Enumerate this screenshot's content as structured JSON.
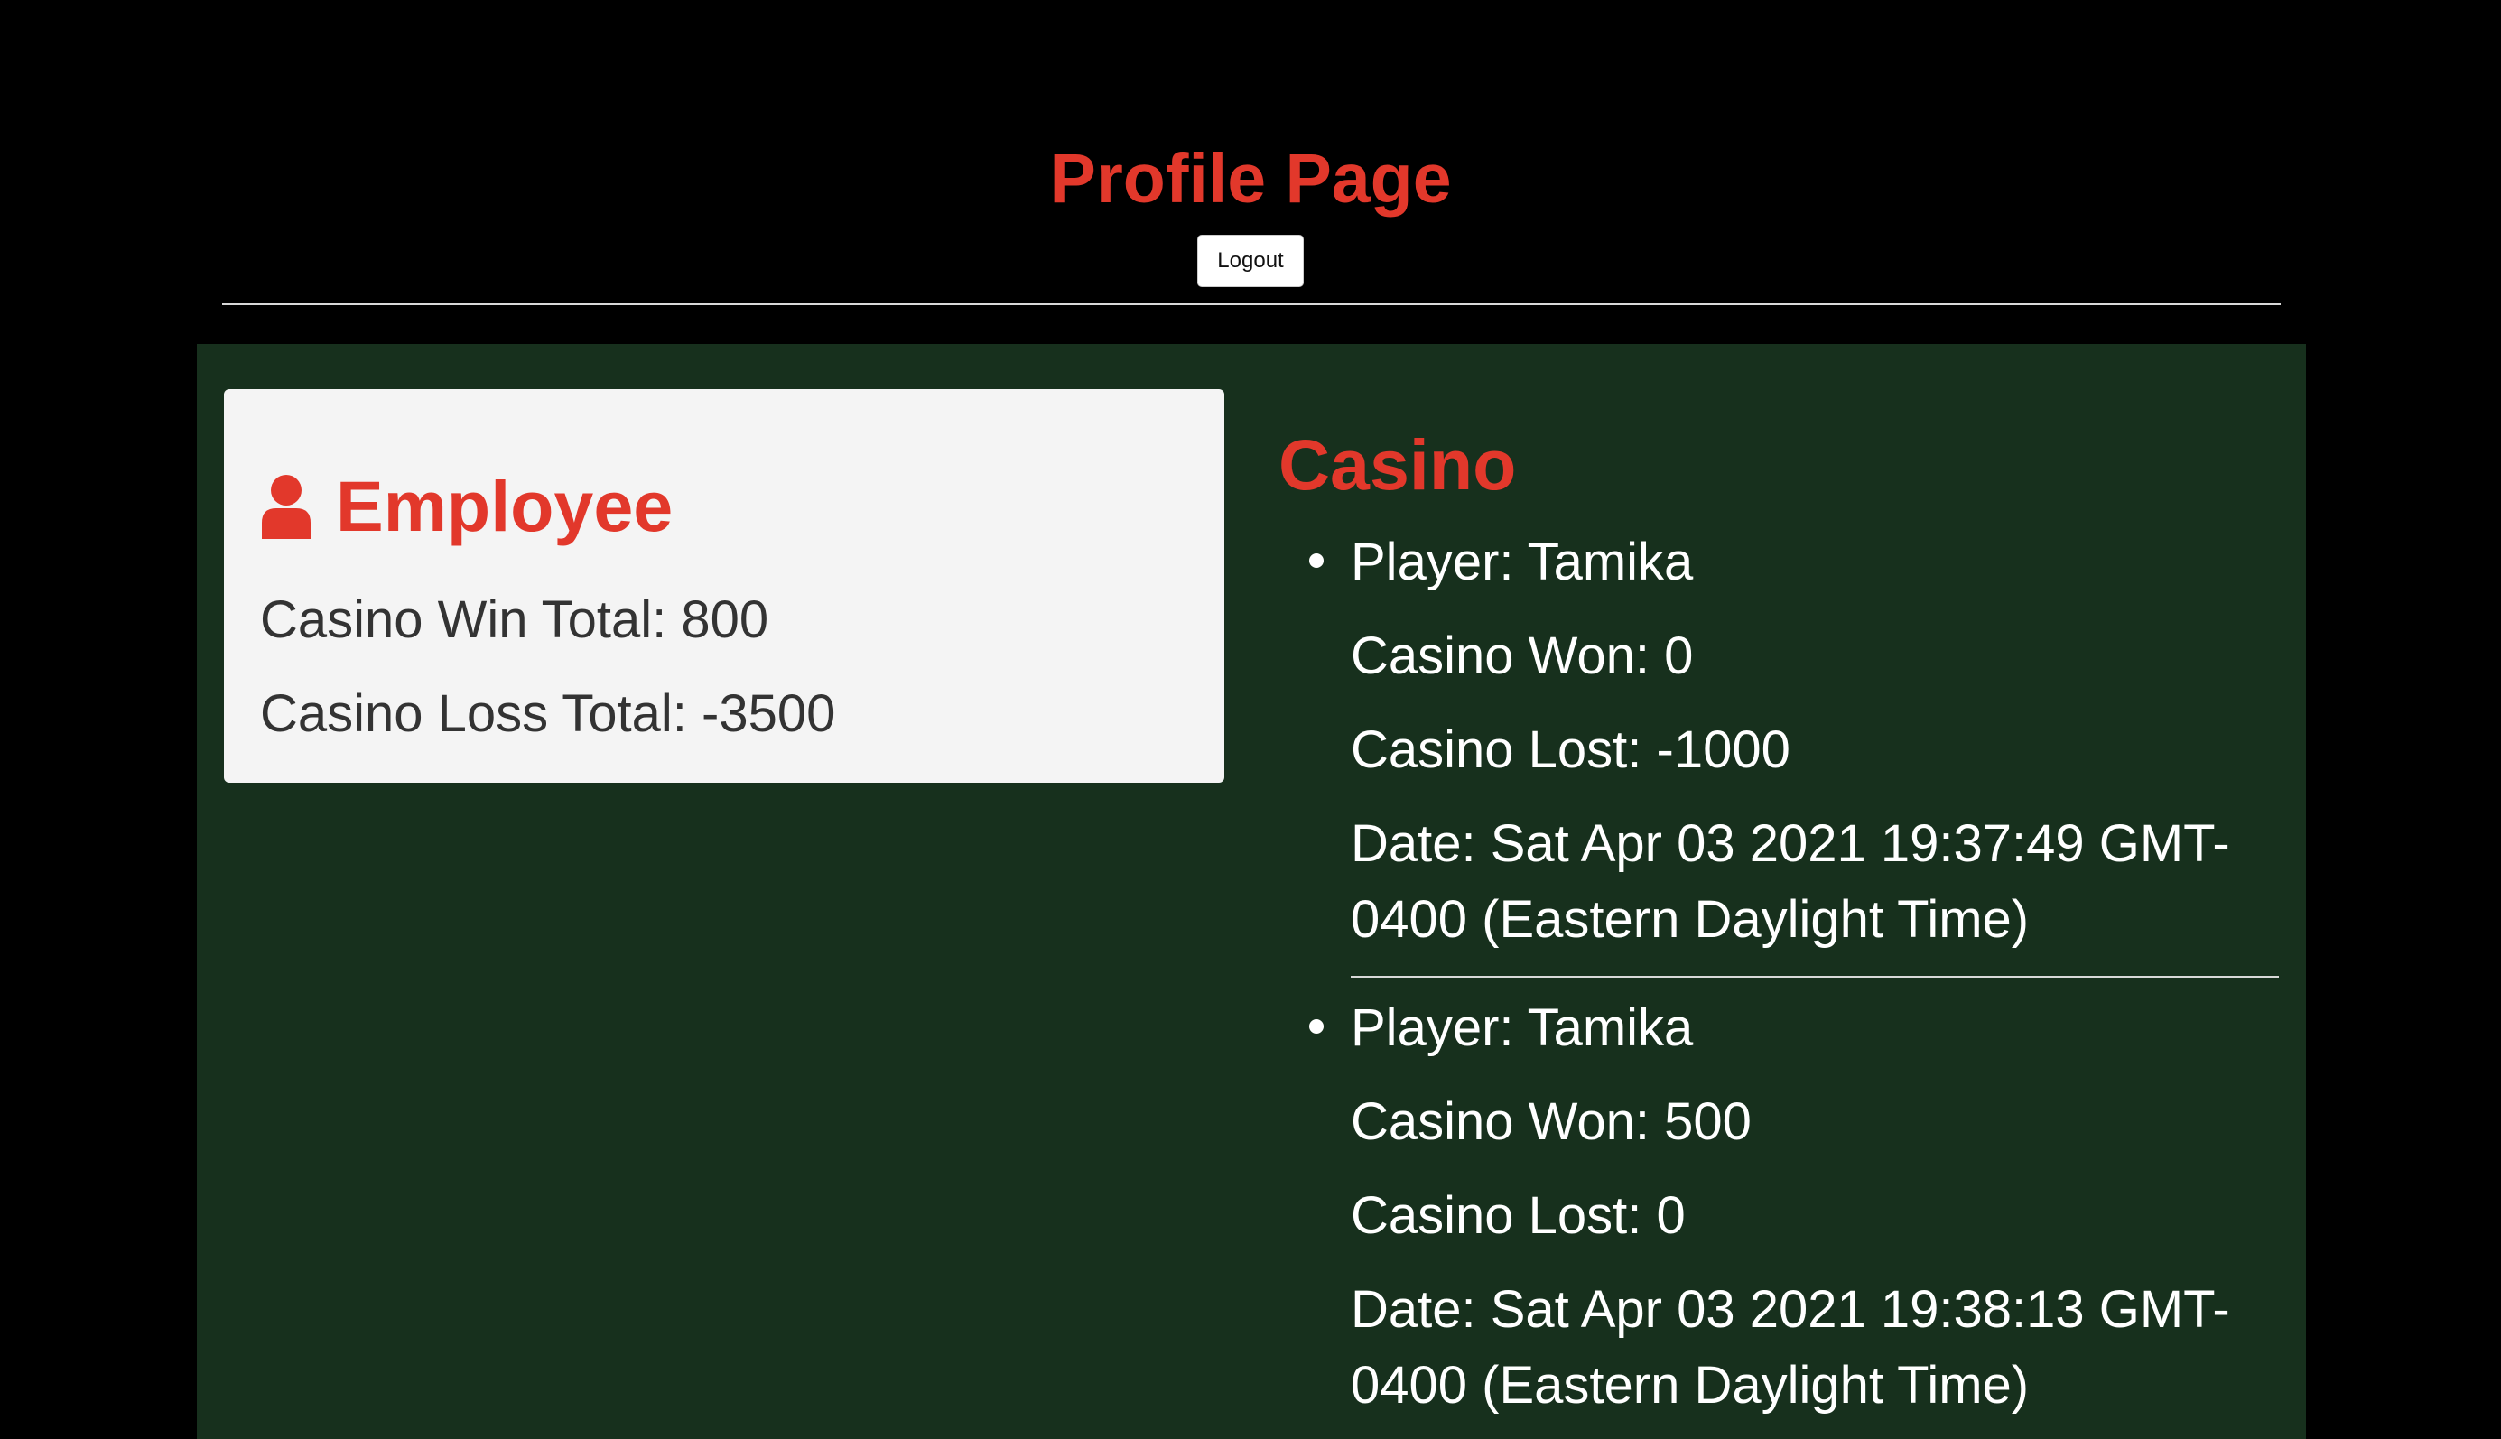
{
  "header": {
    "title": "Profile Page",
    "logout_label": "Logout"
  },
  "employee": {
    "icon": "user-icon",
    "heading": "Employee",
    "win_total_label": "Casino Win Total:",
    "win_total": "800",
    "loss_total_label": "Casino Loss Total:",
    "loss_total": "-3500"
  },
  "casino": {
    "heading": "Casino",
    "entries": [
      {
        "player": "Player: Tamika",
        "won": "Casino Won: 0",
        "lost": "Casino Lost: -1000",
        "date_line1": "Date: Sat Apr 03 2021 19:37:49 GMT-",
        "date_line2": "0400 (Eastern Daylight Time)"
      },
      {
        "player": "Player: Tamika",
        "won": "Casino Won: 500",
        "lost": "Casino Lost: 0",
        "date_line1": "Date: Sat Apr 03 2021 19:38:13 GMT-",
        "date_line2": "0400 (Eastern Daylight Time)"
      }
    ]
  },
  "colors": {
    "background": "#000000",
    "panel": "#17301d",
    "accent": "#e2382b",
    "card": "#f4f4f4"
  }
}
